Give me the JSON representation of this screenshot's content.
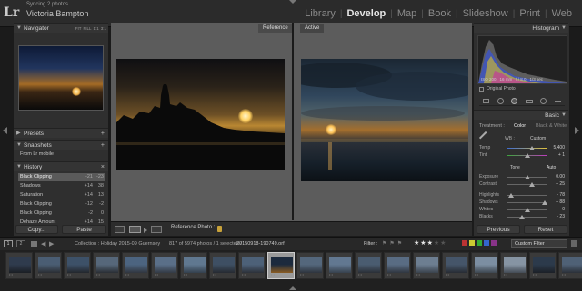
{
  "app": {
    "logo": "Lr",
    "sync_status": "Syncing 2 photos",
    "user_name": "Victoria Bampton"
  },
  "modules": [
    {
      "label": "Library",
      "active": false
    },
    {
      "label": "Develop",
      "active": true
    },
    {
      "label": "Map",
      "active": false
    },
    {
      "label": "Book",
      "active": false
    },
    {
      "label": "Slideshow",
      "active": false
    },
    {
      "label": "Print",
      "active": false
    },
    {
      "label": "Web",
      "active": false
    }
  ],
  "navigator": {
    "title": "Navigator",
    "zoom_options": [
      "FIT",
      "FILL",
      "1:1",
      "3:1"
    ]
  },
  "presets": {
    "title": "Presets",
    "add": "+"
  },
  "snapshots": {
    "title": "Snapshots",
    "add": "+",
    "items": [
      "From Lr mobile"
    ]
  },
  "history": {
    "title": "History",
    "clear": "×",
    "items": [
      {
        "label": "Black Clipping",
        "v1": "-21",
        "v2": "-23",
        "selected": true
      },
      {
        "label": "Shadows",
        "v1": "+14",
        "v2": "38",
        "selected": false
      },
      {
        "label": "Saturation",
        "v1": "+14",
        "v2": "13",
        "selected": false
      },
      {
        "label": "Black Clipping",
        "v1": "-12",
        "v2": "-2",
        "selected": false
      },
      {
        "label": "Black Clipping",
        "v1": "-2",
        "v2": "0",
        "selected": false
      },
      {
        "label": "Dehaze Amount",
        "v1": "+14",
        "v2": "15",
        "selected": false
      }
    ]
  },
  "left_buttons": {
    "copy": "Copy...",
    "paste": "Paste"
  },
  "compare": {
    "reference_label": "Reference",
    "active_label": "Active",
    "reference_photo_label": "Reference Photo :"
  },
  "histogram": {
    "title": "Histogram",
    "info": [
      "ISO 200",
      "16 mm",
      "f / 8.0",
      "1/3 sec"
    ],
    "original_photo": "Original Photo"
  },
  "basic": {
    "title": "Basic",
    "treatment_label": "Treatment :",
    "treatment_color": "Color",
    "treatment_bw": "Black & White",
    "wb_label": "WB :",
    "wb_value": "Custom",
    "temp": {
      "label": "Temp",
      "value": "5,400",
      "pos": 0.62
    },
    "tint": {
      "label": "Tint",
      "value": "+ 1",
      "pos": 0.5
    },
    "tone_label": "Tone",
    "auto_label": "Auto",
    "exposure": {
      "label": "Exposure",
      "value": "0.00",
      "pos": 0.5
    },
    "contrast": {
      "label": "Contrast",
      "value": "+ 25",
      "pos": 0.62
    },
    "highlights": {
      "label": "Highlights",
      "value": "- 78",
      "pos": 0.11
    },
    "shadows": {
      "label": "Shadows",
      "value": "+ 88",
      "pos": 0.94
    },
    "whites": {
      "label": "Whites",
      "value": "0",
      "pos": 0.5
    },
    "blacks": {
      "label": "Blacks",
      "value": "- 23",
      "pos": 0.38
    }
  },
  "right_buttons": {
    "previous": "Previous",
    "reset": "Reset"
  },
  "filmbar": {
    "screen1": "1",
    "screen2": "2",
    "source": "Collection : Holiday 2015-09 Guernsey",
    "count": "817 of 5974 photos / 1 selected /",
    "filename": "20150918-190749.orf",
    "filter_label": "Filter :",
    "stars_rated": 3,
    "custom_filter": "Custom Filter"
  },
  "thumbnails": [
    {
      "color_top": "#2f3b4d",
      "color_bot": "#1b1e24",
      "sel": false
    },
    {
      "color_top": "#4a5d73",
      "color_bot": "#2a2e33",
      "sel": false
    },
    {
      "color_top": "#3d5168",
      "color_bot": "#23272d",
      "sel": false
    },
    {
      "color_top": "#56677a",
      "color_bot": "#2a2e34",
      "sel": false
    },
    {
      "color_top": "#4c6480",
      "color_bot": "#30363e",
      "sel": false
    },
    {
      "color_top": "#5a6f88",
      "color_bot": "#333a44",
      "sel": false
    },
    {
      "color_top": "#607890",
      "color_bot": "#34404d",
      "sel": false
    },
    {
      "color_top": "#3e4f63",
      "color_bot": "#262a31",
      "sel": false
    },
    {
      "color_top": "#4d6178",
      "color_bot": "#2c3139",
      "sel": false
    },
    {
      "color_top": "#1c2a3d",
      "color_bot": "#8a5c23",
      "sel": true
    },
    {
      "color_top": "#54677c",
      "color_bot": "#2e343d",
      "sel": false
    },
    {
      "color_top": "#627891",
      "color_bot": "#37414d",
      "sel": false
    },
    {
      "color_top": "#4a5c70",
      "color_bot": "#2a2f36",
      "sel": false
    },
    {
      "color_top": "#596c83",
      "color_bot": "#30363f",
      "sel": false
    },
    {
      "color_top": "#6d7e91",
      "color_bot": "#3a424c",
      "sel": false
    },
    {
      "color_top": "#455569",
      "color_bot": "#272c33",
      "sel": false
    },
    {
      "color_top": "#7c8ea2",
      "color_bot": "#3d4650",
      "sel": false
    },
    {
      "color_top": "#8694a3",
      "color_bot": "#434b55",
      "sel": false
    },
    {
      "color_top": "#2c3a4b",
      "color_bot": "#1c2027",
      "sel": false
    },
    {
      "color_top": "#4f6176",
      "color_bot": "#2b3038",
      "sel": false
    }
  ]
}
